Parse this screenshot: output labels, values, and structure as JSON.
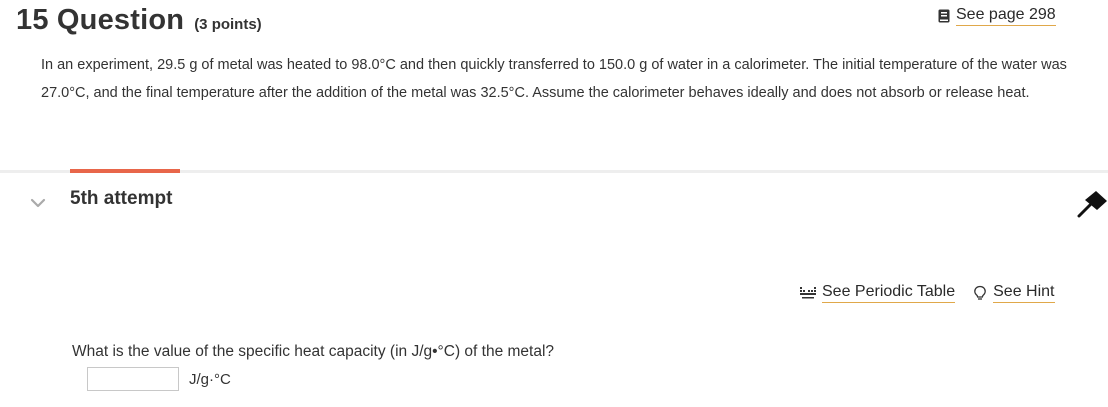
{
  "question": {
    "number_title": "15 Question",
    "points": "(3 points)",
    "see_page": "See page 298",
    "text": "In an experiment, 29.5 g of metal was heated to 98.0°C and then quickly transferred to 150.0 g of water in a calorimeter. The initial temperature of the water was 27.0°C, and the final temperature after the addition of the metal was 32.5°C. Assume the calorimeter behaves ideally and does not absorb or release heat."
  },
  "attempt": {
    "label": "5th attempt"
  },
  "tools": {
    "periodic_table": "See Periodic Table",
    "hint": "See Hint"
  },
  "answer": {
    "prompt": "What is the value of the specific heat capacity (in J/g•°C) of the metal?",
    "value": "",
    "unit": "J/g·°C"
  },
  "colors": {
    "accent": "#e8664a",
    "link_underline": "#e0a84a",
    "divider": "#eeeeee"
  }
}
